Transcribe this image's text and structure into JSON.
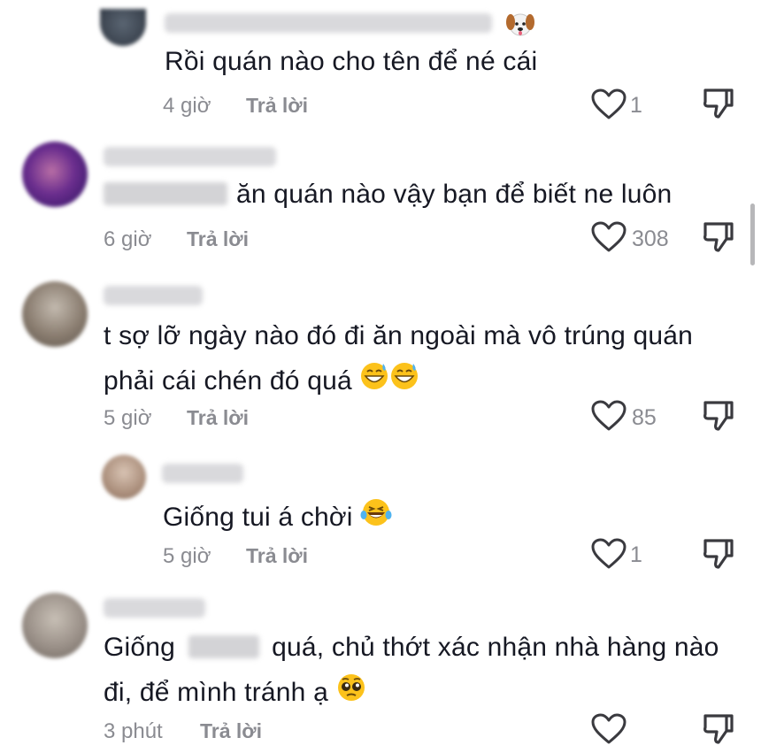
{
  "comments": [
    {
      "id": "c1",
      "reply": true,
      "text_lines": [
        "Rồi quán nào cho tên để né cái"
      ],
      "time": "4 giờ",
      "reply_label": "Trả lời",
      "likes": "1",
      "badge_icon": "dog-face-icon"
    },
    {
      "id": "c2",
      "reply": false,
      "text_lines": [
        "ăn quán nào vậy bạn để biết ne luôn"
      ],
      "time": "6 giờ",
      "reply_label": "Trả lời",
      "likes": "308"
    },
    {
      "id": "c3",
      "reply": false,
      "text_lines": [
        "t sợ lỡ ngày nào đó đi ăn ngoài mà vô trúng quán",
        "phải cái chén đó quá"
      ],
      "time": "5 giờ",
      "reply_label": "Trả lời",
      "likes": "85",
      "emoji_icon": "grinning-sweat-emoji"
    },
    {
      "id": "c4",
      "reply": true,
      "text_lines": [
        "Giống tui á chời"
      ],
      "time": "5 giờ",
      "reply_label": "Trả lời",
      "likes": "1",
      "emoji_icon": "tears-of-joy-emoji"
    },
    {
      "id": "c5",
      "reply": false,
      "text_lines": [
        "Giống",
        "quá, chủ thớt xác nhận nhà hàng nào",
        "đi, để mình tránh ạ"
      ],
      "time": "3 phút",
      "reply_label": "Trả lời",
      "likes": "",
      "emoji_icon": "pleading-face-emoji"
    }
  ],
  "colors": {
    "text": "#161823",
    "meta": "#8a8b91",
    "icon": "#3a3a3f"
  }
}
